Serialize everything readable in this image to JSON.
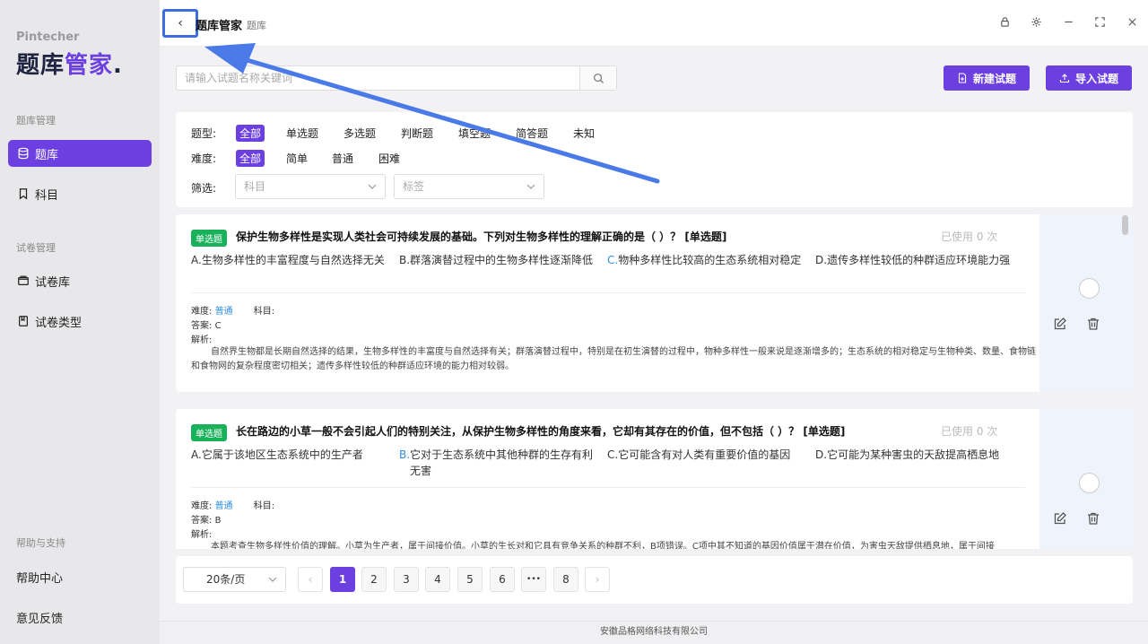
{
  "app": {
    "brand_sub": "Pintecher",
    "brand_title_a": "题库",
    "brand_title_b": "管家",
    "brand_title_dot": ".",
    "accent": "#6c3fe0"
  },
  "sidebar": {
    "section_1": "题库管理",
    "section_2": "试卷管理",
    "section_3": "帮助与支持",
    "items": [
      {
        "label": "题库",
        "icon": "database-icon",
        "active": true
      },
      {
        "label": "科目",
        "icon": "bookmark-icon"
      },
      {
        "label": "试卷库",
        "icon": "folder-icon"
      },
      {
        "label": "试卷类型",
        "icon": "book-icon"
      }
    ],
    "help_items": [
      "帮助中心",
      "意见反馈"
    ]
  },
  "header": {
    "back": "‹",
    "title": "题库管家",
    "crumb": "题库"
  },
  "toolbar": {
    "search_placeholder": "请输入试题名称关键词",
    "new_label": "新建试题",
    "import_label": "导入试题"
  },
  "filters": {
    "type_label": "题型:",
    "type_options": [
      "全部",
      "单选题",
      "多选题",
      "判断题",
      "填空题",
      "简答题",
      "未知"
    ],
    "difficulty_label": "难度:",
    "difficulty_options": [
      "全部",
      "简单",
      "普通",
      "困难"
    ],
    "filter_label": "筛选:",
    "subject_placeholder": "科目",
    "tag_placeholder": "标签"
  },
  "questions": [
    {
      "tag": "单选题",
      "title": "保护生物多样性是实现人类社会可持续发展的基础。下列对生物多样性的理解正确的是（ ）？ [单选题]",
      "used": "已使用 0 次",
      "options": [
        {
          "letter": "A.",
          "text": "生物多样性的丰富程度与自然选择无关"
        },
        {
          "letter": "B.",
          "text": "群落演替过程中的生物多样性逐渐降低"
        },
        {
          "letter": "C.",
          "text": "物种多样性比较高的生态系统相对稳定",
          "correct": true
        },
        {
          "letter": "D.",
          "text": "遗传多样性较低的种群适应环境能力强"
        }
      ],
      "difficulty_label": "难度:",
      "difficulty": "普通",
      "subject_label": "科目:",
      "answer_label": "答案:",
      "answer": "C",
      "analysis_label": "解析:",
      "analysis": "自然界生物都是长期自然选择的结果，生物多样性的丰富度与自然选择有关；群落演替过程中，特别是在初生演替的过程中，物种多样性一般来说是逐渐增多的；生态系统的相对稳定与生物种类、数量、食物链和食物网的复杂程度密切相关；遗传多样性较低的种群适应环境的能力相对较弱。"
    },
    {
      "tag": "单选题",
      "title": "长在路边的小草一般不会引起人们的特别关注，从保护生物多样性的角度来看，它却有其存在的价值，但不包括（ ）？ [单选题]",
      "used": "已使用 0 次",
      "options": [
        {
          "letter": "A.",
          "text": "它属于该地区生态系统中的生产者"
        },
        {
          "letter": "B.",
          "text": "它对于生态系统中其他种群的生存有利无害",
          "correct": true
        },
        {
          "letter": "C.",
          "text": "它可能含有对人类有重要价值的基因"
        },
        {
          "letter": "D.",
          "text": "它可能为某种害虫的天敌提高栖息地"
        }
      ],
      "difficulty_label": "难度:",
      "difficulty": "普通",
      "subject_label": "科目:",
      "answer_label": "答案:",
      "answer": "B",
      "analysis_label": "解析:",
      "analysis": "本题考查生物多样性价值的理解。小草为生产者，属于间接价值。小草的生长对和它具有竞争关系的种群不利，B项错误。C项中其不知道的基因价值属于潜在价值，为害虫天敌提供栖息地，属于间接"
    }
  ],
  "pagination": {
    "page_size": "20条/页",
    "prev": "‹",
    "next": "›",
    "pages": [
      "1",
      "2",
      "3",
      "4",
      "5",
      "6",
      "•••",
      "8"
    ],
    "current": "1"
  },
  "footer": {
    "company": "安徽品格网络科技有限公司"
  }
}
